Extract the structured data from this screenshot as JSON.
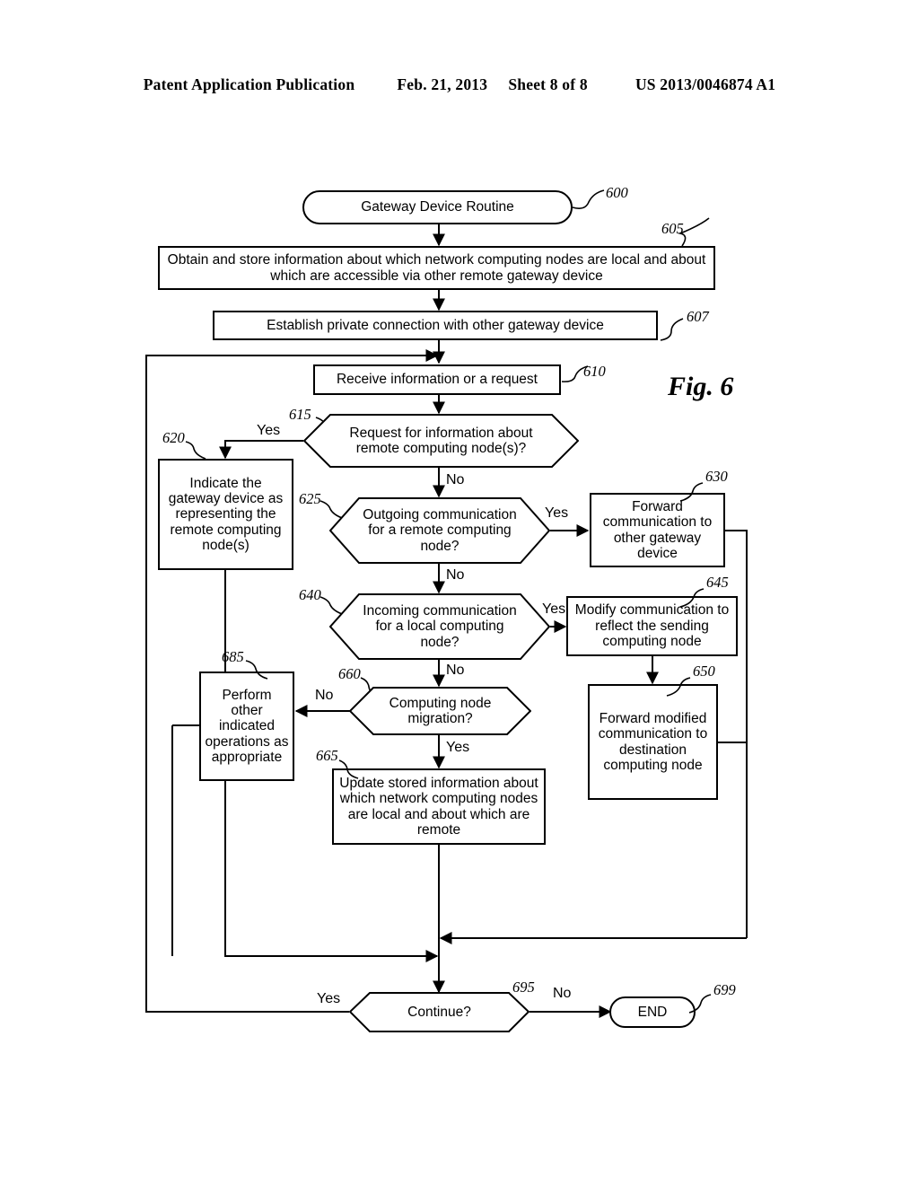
{
  "header": {
    "publication": "Patent Application Publication",
    "date": "Feb. 21, 2013",
    "sheet": "Sheet 8 of 8",
    "document_number": "US 2013/0046874 A1"
  },
  "figure": {
    "label": "Fig. 6",
    "title": "Gateway Device Routine flowchart"
  },
  "nodes": {
    "n600": {
      "ref": "600",
      "text": "Gateway Device Routine",
      "shape": "terminator"
    },
    "n605": {
      "ref": "605",
      "text": "Obtain and store information about which network computing nodes are local and about which are accessible via other remote gateway device",
      "shape": "process"
    },
    "n607": {
      "ref": "607",
      "text": "Establish private connection with other gateway device",
      "shape": "process"
    },
    "n610": {
      "ref": "610",
      "text": "Receive information or a request",
      "shape": "process"
    },
    "n615": {
      "ref": "615",
      "text": "Request for information about remote computing node(s)?",
      "shape": "decision"
    },
    "n620": {
      "ref": "620",
      "text": "Indicate the gateway device as representing the remote computing node(s)",
      "shape": "process"
    },
    "n625": {
      "ref": "625",
      "text": "Outgoing communication for a remote computing node?",
      "shape": "decision"
    },
    "n630": {
      "ref": "630",
      "text": "Forward communication to other gateway device",
      "shape": "process"
    },
    "n640": {
      "ref": "640",
      "text": "Incoming communication for a local computing node?",
      "shape": "decision"
    },
    "n645": {
      "ref": "645",
      "text": "Modify communication to reflect the sending computing node",
      "shape": "process"
    },
    "n650": {
      "ref": "650",
      "text": "Forward modified communication to destination computing node",
      "shape": "process"
    },
    "n660": {
      "ref": "660",
      "text": "Computing node migration?",
      "shape": "decision"
    },
    "n665": {
      "ref": "665",
      "text": "Update stored information about which network computing nodes are local and about which are remote",
      "shape": "process"
    },
    "n685": {
      "ref": "685",
      "text": "Perform other indicated operations as appropriate",
      "shape": "process"
    },
    "n695": {
      "ref": "695",
      "text": "Continue?",
      "shape": "decision"
    },
    "n699": {
      "ref": "699",
      "text": "END",
      "shape": "terminator"
    }
  },
  "edge_labels": {
    "e615_yes": "Yes",
    "e615_no": "No",
    "e625_yes": "Yes",
    "e625_no": "No",
    "e640_yes": "Yes",
    "e640_no": "No",
    "e660_no": "No",
    "e660_yes": "Yes",
    "e695_yes": "Yes",
    "e695_no": "No"
  },
  "colors": {
    "line": "#000000",
    "background": "#ffffff",
    "text": "#000000"
  }
}
